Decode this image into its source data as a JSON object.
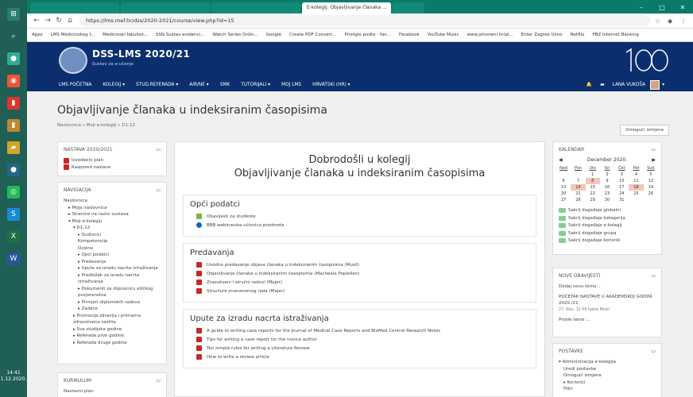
{
  "taskbar": {
    "clock_time": "14:41",
    "clock_date": "1.12.2020."
  },
  "browser": {
    "tabs": [
      {
        "label": ""
      },
      {
        "label": ""
      },
      {
        "label": ""
      },
      {
        "label": "E-kolegij: Objavljivanje članaka ..."
      },
      {
        "label": ""
      }
    ],
    "url": "https://lms.mef.hr/dss/2020-2021/course/view.php?id=15",
    "bookmarks": [
      "Apps",
      "LMS Medicinskog f...",
      "Medicinski fakultet...",
      "SSN Sustav evidenci...",
      "Watch Series Onlin...",
      "Google",
      "Create PDF Convert...",
      "Prisilgle podte - fan...",
      "Facebook",
      "YouTube Music",
      "www.jstvoreni.hr/pl...",
      "Enter Zagreb Ulino",
      "Netflix",
      "PBZ Internet Banking"
    ]
  },
  "site": {
    "title": "DSS-LMS 2020/21",
    "subtitle": "Sustav za e-učenje"
  },
  "menu": {
    "items": [
      "LMS POČETNA",
      "KOLEGIJ ▾",
      "STUD.REFERADA ▾",
      "AIR/NE ▾",
      "SMK",
      "TUTORIJALI ▾",
      "MOJ LMS",
      "HRVATSKI (HR) ▾"
    ],
    "user": "LANA VUKOŠA"
  },
  "page": {
    "title": "Objavljivanje članaka u indeksiranim časopisima",
    "breadcrumb": "Naslovnica  »  Moji e-kolegiji  »  D1-12",
    "edit_button": "Omogući izmjene"
  },
  "nastava": {
    "header": "NASTAVA 2020/2021",
    "items": [
      "Izvedbeni plan",
      "Raspored nastave"
    ]
  },
  "navigacija": {
    "header": "NAVIGACIJA",
    "items": [
      "Naslovnica",
      "▸ Moja naslovnica",
      "▸ Stranice na razini sustava",
      "▾ Moji e-kolegiji",
      "▾ D1-12",
      "▸ Sudionici",
      "Kompetencije",
      "Ocjene",
      "▸ Opći podatci",
      "▸ Predavanja",
      "▸ Upute za izradu nacrta istraživanja",
      "▸ Predložak za izradu nacrta istraživanja",
      "▸ Dokumenti za dopusnicu etičkog povjerenstva",
      "▸ Primjeri diplomskih radova",
      "▸ Zadaće",
      "▸ Promocija zdravlja i primarna zdravstvena zaštita",
      "▸ Sva studijska godine",
      "▸ Referada prve godine",
      "▸ Referada druge godine"
    ]
  },
  "kurikulum": {
    "header": "KURIKULUM",
    "items": [
      "Nastavni plan"
    ]
  },
  "main": {
    "welcome_line1": "Dobrodošli u kolegij",
    "welcome_line2": "Objavljivanje članaka u indeksiranim časopisima",
    "sections": [
      {
        "title": "Opći podatci",
        "items": [
          "Obavijesti za studente",
          "BBB webinarska učionica predmeta"
        ]
      },
      {
        "title": "Predavanja",
        "items": [
          "Uvodno predavanje objava članaka u indeksiranim časopisima (Musil)",
          "Objavljivanje članaka u indeksiranim časopisima (Macheala Popiellen)",
          "Znanstveni i stručni radovi (Majer)",
          "Structure znanstvenog rada (Majer)"
        ]
      },
      {
        "title": "Upute za izradu nacrta istraživanja",
        "items": [
          "A guide to writing case reports for the Journal of Medical Case Reports and BioMed Central Research Notes",
          "Tips for writing a case report for the novice author",
          "Ten simple rules for writing a Literature Review",
          "How to write a review article"
        ]
      }
    ]
  },
  "kalendar": {
    "header": "KALENDAR",
    "month": "December 2020.",
    "days": [
      "Ned",
      "Pon",
      "Uto",
      "Sri",
      "Čet",
      "Pet",
      "Sub"
    ],
    "cells": [
      "",
      "",
      "1",
      "2",
      "3",
      "4",
      "5",
      "6",
      "7",
      "8",
      "9",
      "10",
      "11",
      "12",
      "13",
      "14",
      "15",
      "16",
      "17",
      "18",
      "19",
      "20",
      "21",
      "22",
      "23",
      "24",
      "25",
      "26",
      "27",
      "28",
      "29",
      "30",
      "31",
      "",
      ""
    ],
    "legend": [
      "Sakrij događaje globalni",
      "Sakrij događaje kategorija",
      "Sakrij događaje e-kolegij",
      "Sakrij događaje grupa",
      "Sakrij događaje korisnik"
    ]
  },
  "obavijesti": {
    "header": "NOVE OBAVIJESTI",
    "add": "Dodaj novu temu...",
    "post_title": "POČETAK NASTAVE U AKADEMSKOJ GODINI 2020./21",
    "post_meta": "27. Nov, 12:59  Ivana Musil",
    "older": "Prošle teme ..."
  },
  "postavke": {
    "header": "POSTAVKE",
    "items": [
      "▾ Administracija e-kolegija",
      "Uredi postavke",
      "Omogući izmjene",
      "▸ Korisnici",
      "Filtri"
    ]
  }
}
